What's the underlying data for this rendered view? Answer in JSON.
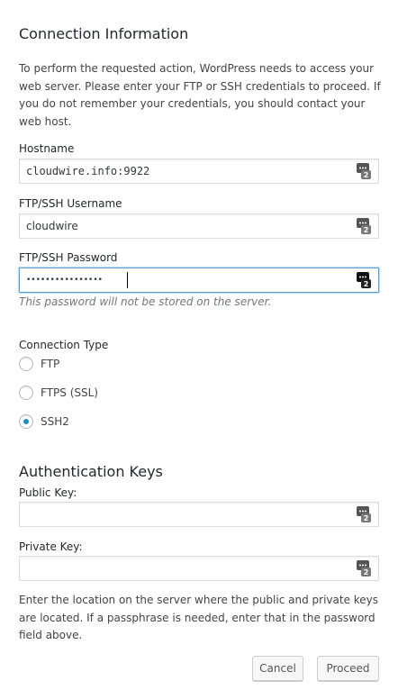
{
  "section_title": "Connection Information",
  "intro_text": "To perform the requested action, WordPress needs to access your web server. Please enter your FTP or SSH credentials to proceed. If you do not remember your credentials, you should contact your web host.",
  "hostname": {
    "label": "Hostname",
    "value": "cloudwire.info:9922",
    "icon": "keepass-icon"
  },
  "username": {
    "label": "FTP/SSH Username",
    "value": "cloudwire",
    "icon": "keepass-icon"
  },
  "password": {
    "label": "FTP/SSH Password",
    "value": "••••••••••••••••",
    "icon": "keepass-icon",
    "hint": "This password will not be stored on the server."
  },
  "connection_type": {
    "label": "Connection Type",
    "options": [
      {
        "label": "FTP",
        "checked": false
      },
      {
        "label": "FTPS (SSL)",
        "checked": false
      },
      {
        "label": "SSH2",
        "checked": true
      }
    ]
  },
  "auth_keys": {
    "title": "Authentication Keys",
    "public_key_label": "Public Key:",
    "public_key_value": "",
    "private_key_label": "Private Key:",
    "private_key_value": "",
    "note": "Enter the location on the server where the public and private keys are located. If a passphrase is needed, enter that in the password field above."
  },
  "buttons": {
    "cancel": "Cancel",
    "proceed": "Proceed"
  },
  "colors": {
    "text": "#23282d",
    "accent": "#1e8cbe",
    "focus_border": "#5b9dd9",
    "hint": "#72777c"
  }
}
